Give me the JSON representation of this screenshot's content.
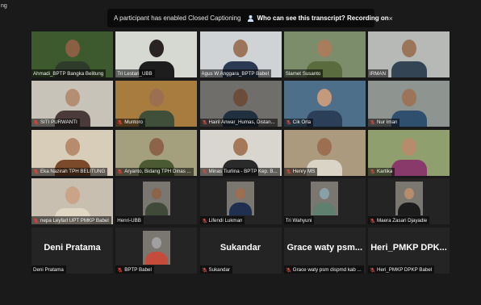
{
  "app_tag": "ng",
  "banner": {
    "message": "A participant has enabled Closed Captioning",
    "link": "Who can see this transcript? Recording on",
    "close": "×"
  },
  "colors": {
    "active_border": "#b7e36b",
    "muted_mic": "#e0453a",
    "tile_bg": "#242424"
  },
  "participants": [
    {
      "name": "Ahmadi_BPTP Bangka Belitung",
      "muted": false,
      "video": true,
      "bg": "#3c5a2e",
      "skin": "#8a5f44",
      "shirt": "#2f3b2a"
    },
    {
      "name": "Tri Lestari_UBB",
      "muted": false,
      "video": true,
      "active": true,
      "bg": "#d6d9d2",
      "skin": "#2a2323",
      "shirt": "#1d1d1d"
    },
    {
      "name": "Agus W Anggara_BPTP Babel",
      "muted": false,
      "video": true,
      "bg": "#cfd3d6",
      "skin": "#9b7459",
      "shirt": "#2b3a52"
    },
    {
      "name": "Slamet Susanto",
      "muted": false,
      "video": true,
      "bg": "#7b8d6a",
      "skin": "#a97c5c",
      "shirt": "#5a6b3d"
    },
    {
      "name": "IRMAN",
      "muted": false,
      "video": true,
      "bg": "#b7b9b7",
      "skin": "#9b7459",
      "shirt": "#334455"
    },
    {
      "name": "SITI PURWANTI",
      "muted": true,
      "video": true,
      "bg": "#c7c3b8",
      "skin": "#b48e72",
      "shirt": "#4a3a3a"
    },
    {
      "name": "Muntoro",
      "muted": true,
      "video": true,
      "bg": "#a77c3e",
      "skin": "#9b6f4f",
      "shirt": "#3f4f3a"
    },
    {
      "name": "Hairil Anwar_Humas, Distan...",
      "muted": true,
      "video": true,
      "bg": "#6f6e6a",
      "skin": "#6b4d3a",
      "shirt": "#20303f"
    },
    {
      "name": "Cik Orla",
      "muted": true,
      "video": true,
      "bg": "#4d6f8a",
      "skin": "#c49a7c",
      "shirt": "#2b3f58"
    },
    {
      "name": "Nur Iman",
      "muted": true,
      "video": true,
      "bg": "#8e9590",
      "skin": "#9b7459",
      "shirt": "#2f4f6f"
    },
    {
      "name": "Eka Nazirah TPH BELITUNG",
      "muted": true,
      "video": true,
      "bg": "#d8cdb8",
      "skin": "#b68c6c",
      "shirt": "#7a4a2a"
    },
    {
      "name": "Aryanto, Bidang TPH Dinas ...",
      "muted": true,
      "video": true,
      "bg": "#a49f7c",
      "skin": "#8b6449",
      "shirt": "#4a5a32"
    },
    {
      "name": "Minas Tiurlina - BPTP Kep. B...",
      "muted": true,
      "video": true,
      "bg": "#d9d6cf",
      "skin": "#a5785a",
      "shirt": "#2a2a2a"
    },
    {
      "name": "Henry MS",
      "muted": true,
      "video": true,
      "bg": "#ab9a7e",
      "skin": "#9b6f4f",
      "shirt": "#d9d4c5"
    },
    {
      "name": "Kartika",
      "muted": true,
      "video": true,
      "bg": "#8fa06e",
      "skin": "#b68c6c",
      "shirt": "#8a3a6a"
    },
    {
      "name": "nepa Leyfarl UPT PMKP Babel",
      "muted": true,
      "video": true,
      "bg": "#c8bfb0",
      "skin": "#c9a487",
      "shirt": "#e0d6c4"
    },
    {
      "name": "Henri-UBB",
      "muted": false,
      "video": true,
      "bg": "#242424",
      "skin": "#8b6449",
      "shirt": "#3f4a3a",
      "small": true
    },
    {
      "name": "Lifendi Lukman",
      "muted": true,
      "video": true,
      "bg": "#242424",
      "skin": "#9b6f4f",
      "shirt": "#1f2f4f",
      "small": true
    },
    {
      "name": "Tri Wahyuni",
      "muted": false,
      "video": true,
      "bg": "#242424",
      "skin": "#88a0a8",
      "shirt": "#5f7f6f",
      "small": true
    },
    {
      "name": "Maera Zasari Djayadie",
      "muted": true,
      "video": true,
      "bg": "#242424",
      "skin": "#b68c6c",
      "shirt": "#1c1c1c",
      "small": true
    },
    {
      "name": "Deni Pratama",
      "muted": false,
      "video": false,
      "display": "Deni Pratama"
    },
    {
      "name": "BPTP Babel",
      "muted": true,
      "video": true,
      "bg": "#242424",
      "skin": "#a0a0a0",
      "shirt": "#c54c3a",
      "small": true
    },
    {
      "name": "Sukandar",
      "muted": true,
      "video": false,
      "display": "Sukandar"
    },
    {
      "name": "Grace waty psm dispmd kab ...",
      "muted": true,
      "video": false,
      "display": "Grace waty psm..."
    },
    {
      "name": "Heri_PMKP DPKP Babel",
      "muted": true,
      "video": false,
      "display": "Heri_PMKP DPK..."
    }
  ]
}
